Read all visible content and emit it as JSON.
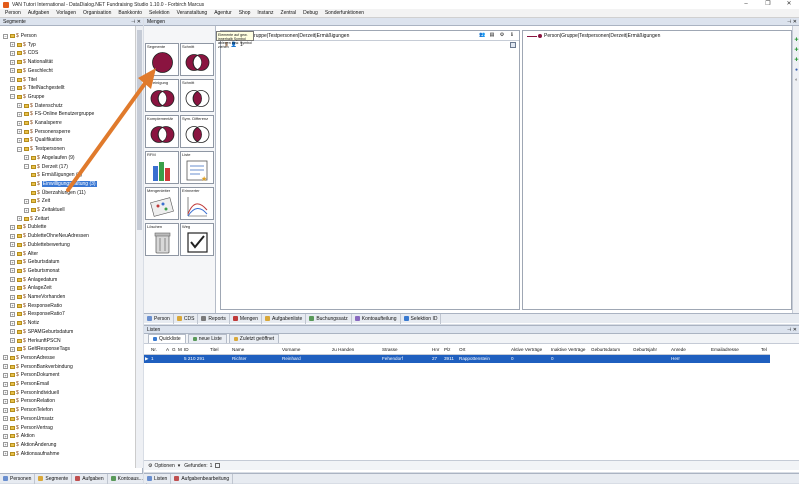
{
  "window": {
    "title": "VAN Tutori International - DataDialog.NET Fundraising Studio 1.10.0 - Forbirch Marcus",
    "minimize_glyph": "–",
    "maximize_glyph": "❐",
    "close_glyph": "✕"
  },
  "menu": [
    "Person",
    "Aufgaben",
    "Vorlagen",
    "Organisation",
    "Bankkonto",
    "Selektion",
    "Veranstaltung",
    "Agentur",
    "Shop",
    "Instanz",
    "Zentral",
    "Debug",
    "Sonderfunktionen"
  ],
  "segments_panel": {
    "title": "Segmente",
    "pin": "⊣",
    "close": "✕",
    "tree": [
      {
        "label": "Person",
        "level": 0,
        "expander": "−"
      },
      {
        "label": "Typ",
        "level": 1,
        "expander": "+"
      },
      {
        "label": "CDS",
        "level": 1,
        "expander": "+"
      },
      {
        "label": "Nationalität",
        "level": 1,
        "expander": "+"
      },
      {
        "label": "Geschlecht",
        "level": 1,
        "expander": "+"
      },
      {
        "label": "Titel",
        "level": 1,
        "expander": "+"
      },
      {
        "label": "TitelNachgestellt",
        "level": 1,
        "expander": "+"
      },
      {
        "label": "Gruppe",
        "level": 1,
        "expander": "−"
      },
      {
        "label": "Datenschutz",
        "level": 2,
        "expander": "+"
      },
      {
        "label": "FS-Online Benutzergruppe",
        "level": 2,
        "expander": "+"
      },
      {
        "label": "Kanalsperre",
        "level": 2,
        "expander": "+"
      },
      {
        "label": "Personensperre",
        "level": 2,
        "expander": "+"
      },
      {
        "label": "Qualifikation",
        "level": 2,
        "expander": "+"
      },
      {
        "label": "Testpersonen",
        "level": 2,
        "expander": "−"
      },
      {
        "label": "Abgelaufen (9)",
        "level": 3,
        "expander": "+"
      },
      {
        "label": "Derzeit (17)",
        "level": 3,
        "expander": "−"
      },
      {
        "label": "Ermäßigungen (1)",
        "level": 4,
        "expander": ""
      },
      {
        "label": "Einwilligungshaltung (3)",
        "level": 4,
        "expander": "",
        "selected": true
      },
      {
        "label": "Überzahlungen (11)",
        "level": 4,
        "expander": ""
      },
      {
        "label": "Zeit",
        "level": 3,
        "expander": "+"
      },
      {
        "label": "Zeitaktuell",
        "level": 3,
        "expander": "+"
      },
      {
        "label": "Zeitart",
        "level": 2,
        "expander": "+"
      },
      {
        "label": "Dublette",
        "level": 1,
        "expander": "+"
      },
      {
        "label": "DubletteOhneNeuAdressen",
        "level": 1,
        "expander": "+"
      },
      {
        "label": "Dublettebewertung",
        "level": 1,
        "expander": "+"
      },
      {
        "label": "Alter",
        "level": 1,
        "expander": "+"
      },
      {
        "label": "Geburtsdatum",
        "level": 1,
        "expander": "+"
      },
      {
        "label": "Geburtsmonat",
        "level": 1,
        "expander": "+"
      },
      {
        "label": "Anlagedatum",
        "level": 1,
        "expander": "+"
      },
      {
        "label": "AnlageZeit",
        "level": 1,
        "expander": "+"
      },
      {
        "label": "NameVorhanden",
        "level": 1,
        "expander": "+"
      },
      {
        "label": "ResponseRatio",
        "level": 1,
        "expander": "+"
      },
      {
        "label": "ResponseRatio7",
        "level": 1,
        "expander": "+"
      },
      {
        "label": "Notiz",
        "level": 1,
        "expander": "+"
      },
      {
        "label": "SPAMGeburtsdatum",
        "level": 1,
        "expander": "+"
      },
      {
        "label": "HerkunftPSCN",
        "level": 1,
        "expander": "+"
      },
      {
        "label": "GeltResponseTags",
        "level": 1,
        "expander": "+"
      },
      {
        "label": "PersonAdresse",
        "level": 0,
        "expander": "+"
      },
      {
        "label": "PersonBankverbindung",
        "level": 0,
        "expander": "+"
      },
      {
        "label": "PersonDokument",
        "level": 0,
        "expander": "+"
      },
      {
        "label": "PersonEmail",
        "level": 0,
        "expander": "+"
      },
      {
        "label": "PersonIndividuell",
        "level": 0,
        "expander": "+"
      },
      {
        "label": "PersonRelation",
        "level": 0,
        "expander": "+"
      },
      {
        "label": "PersonTelefon",
        "level": 0,
        "expander": "+"
      },
      {
        "label": "PersonUmsatz",
        "level": 0,
        "expander": "+"
      },
      {
        "label": "PersonVertrag",
        "level": 0,
        "expander": "+"
      },
      {
        "label": "Aktion",
        "level": 0,
        "expander": "+"
      },
      {
        "label": "AktionÄnderung",
        "level": 0,
        "expander": "+"
      },
      {
        "label": "Aktionsaufnahme",
        "level": 0,
        "expander": "+"
      }
    ],
    "bottom_tabs": [
      "Personen",
      "Segmente",
      "Aufgaben",
      "Kontoaus..."
    ]
  },
  "mengen_panel": {
    "title": "Mengen",
    "tiles": [
      {
        "label": "Segmente",
        "icon": "segment-circle-icon"
      },
      {
        "label": "Schnitt",
        "icon": "intersection-icon"
      },
      {
        "label": "Vereinigung",
        "icon": "union-icon"
      },
      {
        "label": "Schnitt",
        "icon": "intersection-outline-icon"
      },
      {
        "label": "Komplementär",
        "icon": "complement-icon"
      },
      {
        "label": "Sym. Differenz",
        "icon": "symmetric-difference-icon"
      },
      {
        "label": "RFM",
        "icon": "bar-chart-icon"
      },
      {
        "label": "Liste",
        "icon": "list-icon"
      },
      {
        "label": "Mengenleiter",
        "icon": "scatter-icon"
      },
      {
        "label": "Erinnerter",
        "icon": "line-chart-icon"
      },
      {
        "label": "Löschen",
        "icon": "trash-icon"
      },
      {
        "label": "Weg",
        "icon": "checkbox-icon"
      }
    ],
    "tooltip": "Elemente auf gew. innerhalb Symbol ablegen bzw. Symbol ziehen",
    "query": {
      "path": "Person|Gruppe|Testpersonen|Derzeit|Ermäßigungen",
      "sub_label": "1"
    },
    "result": {
      "path": "Person|Gruppe|Testpersonen|Derzeit|Ermäßigungen"
    },
    "tabs": [
      "Person",
      "CDS",
      "Reports",
      "Mengen",
      "Aufgabenliste",
      "Buchungssatz",
      "Kontoaufteilung",
      "Selektion ID"
    ]
  },
  "listen_panel": {
    "title": "Listen",
    "tabs": [
      "Quickliste",
      "neue Liste",
      "Zuletzt geöffnet"
    ],
    "columns": [
      "",
      "Nr.",
      "A",
      "G",
      "M",
      "ID",
      "Titel",
      "Name",
      "Vorname",
      "zu Handen",
      "Strasse",
      "Hnr",
      "Plz",
      "Ort",
      "Aktive Verträge",
      "Inaktive Verträge",
      "Geburtsdatum",
      "Geburtsjahr",
      "Anrede",
      "Emailadresse",
      "Tel"
    ],
    "rows": [
      [
        "▶",
        "1",
        "",
        "",
        "",
        "5 210 291",
        "",
        "Richter",
        "Reinhard",
        "",
        "Fehendorf",
        "27",
        "3911",
        "Rappottenstein",
        "0",
        "0",
        "",
        "",
        "Herr",
        "",
        ""
      ]
    ],
    "footer": {
      "options": "Optionen",
      "found_label": "Gefunden:",
      "found_value": "1"
    },
    "bottom_tabs": [
      "Listen",
      "Aufgabenbearbeitung"
    ]
  },
  "colors": {
    "accent_blue": "#1f5fbf",
    "set_purple": "#8a1440",
    "arrow_orange": "#e07a2c"
  }
}
